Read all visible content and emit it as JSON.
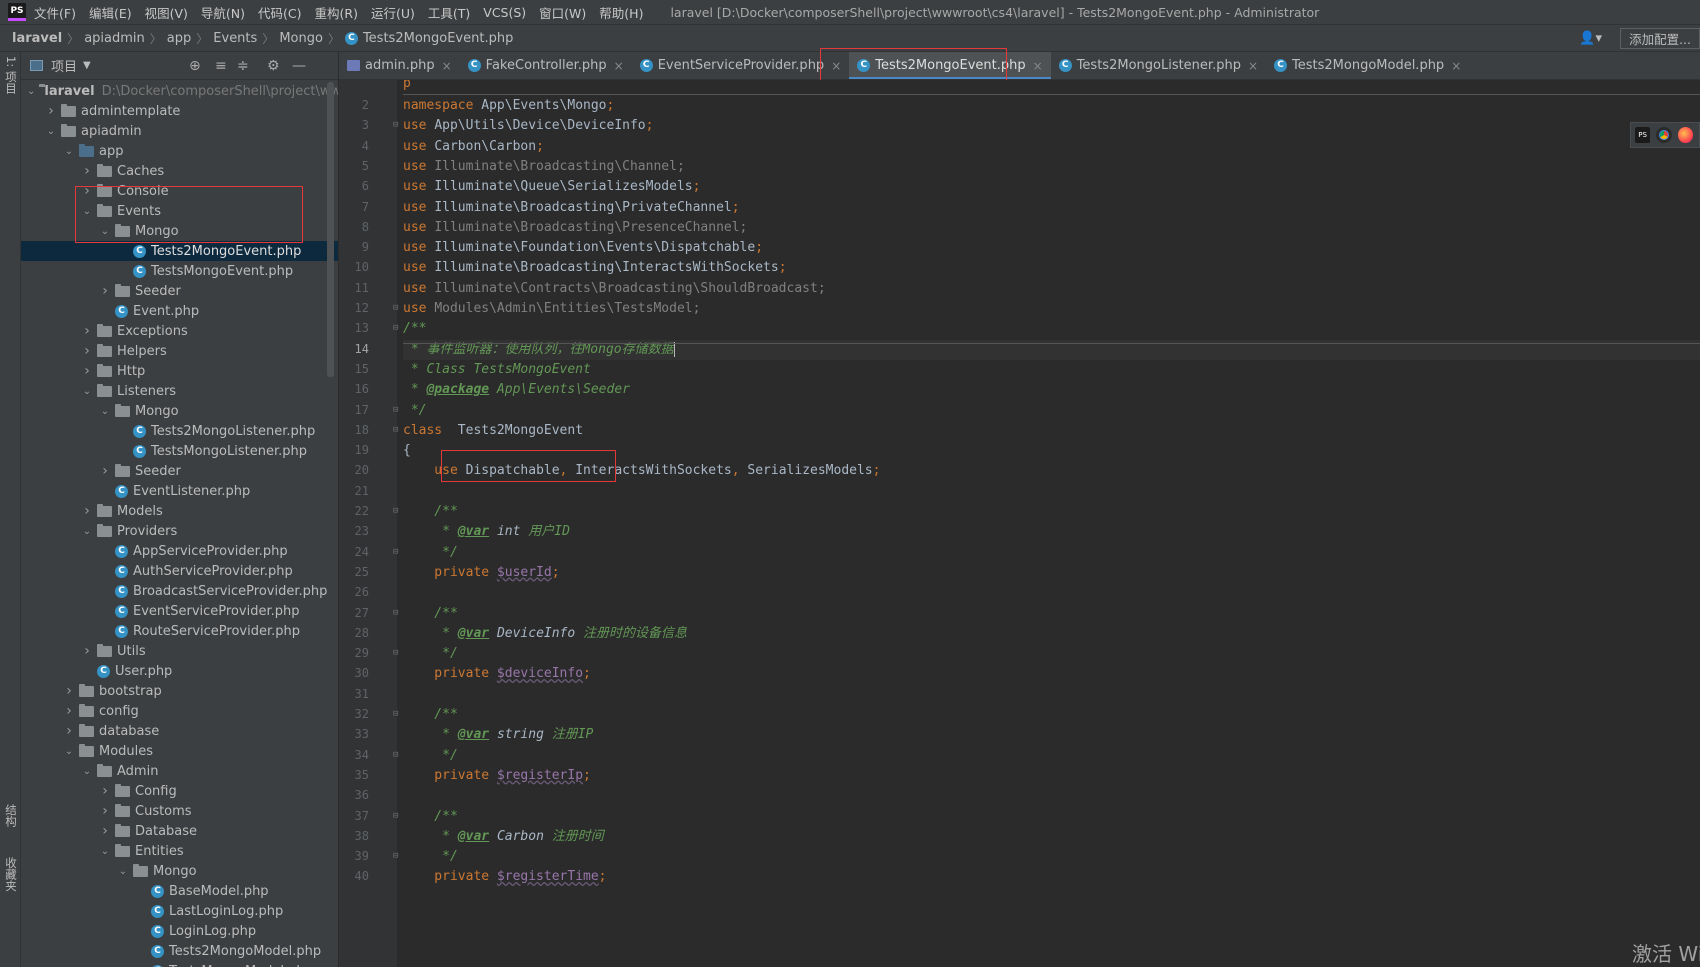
{
  "menubar": {
    "logo": "PS",
    "items": [
      "文件(F)",
      "编辑(E)",
      "视图(V)",
      "导航(N)",
      "代码(C)",
      "重构(R)",
      "运行(U)",
      "工具(T)",
      "VCS(S)",
      "窗口(W)",
      "帮助(H)"
    ],
    "window_title": "laravel [D:\\Docker\\composerShell\\project\\wwwroot\\cs4\\laravel] - Tests2MongoEvent.php - Administrator"
  },
  "breadcrumb": {
    "items": [
      "laravel",
      "apiadmin",
      "app",
      "Events",
      "Mongo",
      "Tests2MongoEvent.php"
    ],
    "add_config_label": "添加配置..."
  },
  "left_strip": {
    "top_tab": "1: 项目",
    "bottom_tab_1": "结构",
    "bottom_tab_2": "收藏夹"
  },
  "project": {
    "title": "项目",
    "root_name": "laravel",
    "root_path": "D:\\Docker\\composerShell\\project\\wwwroot\\cs4\\laravel",
    "tree": [
      {
        "label": "admintemplate",
        "depth": 1,
        "type": "folder",
        "open": false
      },
      {
        "label": "apiadmin",
        "depth": 1,
        "type": "folder",
        "open": true
      },
      {
        "label": "app",
        "depth": 2,
        "type": "folder-blue",
        "open": true
      },
      {
        "label": "Caches",
        "depth": 3,
        "type": "folder",
        "open": false
      },
      {
        "label": "Console",
        "depth": 3,
        "type": "folder",
        "open": false
      },
      {
        "label": "Events",
        "depth": 3,
        "type": "folder",
        "open": true
      },
      {
        "label": "Mongo",
        "depth": 4,
        "type": "folder",
        "open": true
      },
      {
        "label": "Tests2MongoEvent.php",
        "depth": 5,
        "type": "file",
        "selected": true
      },
      {
        "label": "TestsMongoEvent.php",
        "depth": 5,
        "type": "file"
      },
      {
        "label": "Seeder",
        "depth": 4,
        "type": "folder",
        "open": false
      },
      {
        "label": "Event.php",
        "depth": 4,
        "type": "file"
      },
      {
        "label": "Exceptions",
        "depth": 3,
        "type": "folder",
        "open": false
      },
      {
        "label": "Helpers",
        "depth": 3,
        "type": "folder",
        "open": false
      },
      {
        "label": "Http",
        "depth": 3,
        "type": "folder",
        "open": false
      },
      {
        "label": "Listeners",
        "depth": 3,
        "type": "folder",
        "open": true
      },
      {
        "label": "Mongo",
        "depth": 4,
        "type": "folder",
        "open": true
      },
      {
        "label": "Tests2MongoListener.php",
        "depth": 5,
        "type": "file"
      },
      {
        "label": "TestsMongoListener.php",
        "depth": 5,
        "type": "file"
      },
      {
        "label": "Seeder",
        "depth": 4,
        "type": "folder",
        "open": false
      },
      {
        "label": "EventListener.php",
        "depth": 4,
        "type": "file"
      },
      {
        "label": "Models",
        "depth": 3,
        "type": "folder",
        "open": false
      },
      {
        "label": "Providers",
        "depth": 3,
        "type": "folder",
        "open": true
      },
      {
        "label": "AppServiceProvider.php",
        "depth": 4,
        "type": "file"
      },
      {
        "label": "AuthServiceProvider.php",
        "depth": 4,
        "type": "file"
      },
      {
        "label": "BroadcastServiceProvider.php",
        "depth": 4,
        "type": "file"
      },
      {
        "label": "EventServiceProvider.php",
        "depth": 4,
        "type": "file"
      },
      {
        "label": "RouteServiceProvider.php",
        "depth": 4,
        "type": "file"
      },
      {
        "label": "Utils",
        "depth": 3,
        "type": "folder",
        "open": false
      },
      {
        "label": "User.php",
        "depth": 3,
        "type": "file"
      },
      {
        "label": "bootstrap",
        "depth": 2,
        "type": "folder",
        "open": false
      },
      {
        "label": "config",
        "depth": 2,
        "type": "folder",
        "open": false
      },
      {
        "label": "database",
        "depth": 2,
        "type": "folder",
        "open": false
      },
      {
        "label": "Modules",
        "depth": 2,
        "type": "folder",
        "open": true
      },
      {
        "label": "Admin",
        "depth": 3,
        "type": "folder",
        "open": true
      },
      {
        "label": "Config",
        "depth": 4,
        "type": "folder",
        "open": false
      },
      {
        "label": "Customs",
        "depth": 4,
        "type": "folder",
        "open": false
      },
      {
        "label": "Database",
        "depth": 4,
        "type": "folder",
        "open": false
      },
      {
        "label": "Entities",
        "depth": 4,
        "type": "folder",
        "open": true
      },
      {
        "label": "Mongo",
        "depth": 5,
        "type": "folder",
        "open": true
      },
      {
        "label": "BaseModel.php",
        "depth": 6,
        "type": "file"
      },
      {
        "label": "LastLoginLog.php",
        "depth": 6,
        "type": "file"
      },
      {
        "label": "LoginLog.php",
        "depth": 6,
        "type": "file"
      },
      {
        "label": "Tests2MongoModel.php",
        "depth": 6,
        "type": "file"
      },
      {
        "label": "TestsMongoModel.php",
        "depth": 6,
        "type": "file"
      }
    ]
  },
  "tabs": [
    {
      "label": "admin.php",
      "icon": "php-file-icon",
      "active": false
    },
    {
      "label": "FakeController.php",
      "icon": "class-icon",
      "active": false
    },
    {
      "label": "EventServiceProvider.php",
      "icon": "class-icon",
      "active": false
    },
    {
      "label": "Tests2MongoEvent.php",
      "icon": "class-icon",
      "active": true
    },
    {
      "label": "Tests2MongoListener.php",
      "icon": "class-icon",
      "active": false
    },
    {
      "label": "Tests2MongoModel.php",
      "icon": "class-icon",
      "active": false
    }
  ],
  "editor": {
    "current_line": 14,
    "lines": [
      {
        "n": 2,
        "segs": [
          [
            "k",
            "namespace "
          ],
          [
            "",
            "App\\Events\\Mongo"
          ],
          [
            "p",
            ";"
          ]
        ]
      },
      {
        "n": 3,
        "fold": true,
        "segs": [
          [
            "k",
            "use "
          ],
          [
            "",
            "App\\Utils\\Device\\DeviceInfo"
          ],
          [
            "p",
            ";"
          ]
        ]
      },
      {
        "n": 4,
        "segs": [
          [
            "k",
            "use "
          ],
          [
            "",
            "Carbon\\Carbon"
          ],
          [
            "p",
            ";"
          ]
        ]
      },
      {
        "n": 5,
        "segs": [
          [
            "k",
            "use "
          ],
          [
            "g",
            "Illuminate\\Broadcasting\\Channel;"
          ]
        ]
      },
      {
        "n": 6,
        "segs": [
          [
            "k",
            "use "
          ],
          [
            "",
            "Illuminate\\Queue\\SerializesModels"
          ],
          [
            "p",
            ";"
          ]
        ]
      },
      {
        "n": 7,
        "segs": [
          [
            "k",
            "use "
          ],
          [
            "",
            "Illuminate\\Broadcasting\\PrivateChannel"
          ],
          [
            "p",
            ";"
          ]
        ]
      },
      {
        "n": 8,
        "segs": [
          [
            "k",
            "use "
          ],
          [
            "g",
            "Illuminate\\Broadcasting\\PresenceChannel;"
          ]
        ]
      },
      {
        "n": 9,
        "segs": [
          [
            "k",
            "use "
          ],
          [
            "",
            "Illuminate\\Foundation\\Events\\Dispatchable"
          ],
          [
            "p",
            ";"
          ]
        ]
      },
      {
        "n": 10,
        "segs": [
          [
            "k",
            "use "
          ],
          [
            "",
            "Illuminate\\Broadcasting\\InteractsWithSockets"
          ],
          [
            "p",
            ";"
          ]
        ]
      },
      {
        "n": 11,
        "segs": [
          [
            "k",
            "use "
          ],
          [
            "g",
            "Illuminate\\Contracts\\Broadcasting\\ShouldBroadcast;"
          ]
        ]
      },
      {
        "n": 12,
        "fold": true,
        "segs": [
          [
            "k",
            "use "
          ],
          [
            "g",
            "Modules\\Admin\\Entities\\TestsModel;"
          ]
        ]
      },
      {
        "n": 13,
        "fold": true,
        "segs": [
          [
            "d",
            "/**"
          ]
        ]
      },
      {
        "n": 14,
        "segs": [
          [
            "d",
            " * 事件监听器：使用队列，往Mongo存储数据"
          ]
        ]
      },
      {
        "n": 15,
        "segs": [
          [
            "d",
            " * Class TestsMongoEvent"
          ]
        ]
      },
      {
        "n": 16,
        "segs": [
          [
            "d",
            " * "
          ],
          [
            "dt",
            "@package"
          ],
          [
            "d",
            " App\\Events\\Seeder"
          ]
        ]
      },
      {
        "n": 17,
        "fold": true,
        "segs": [
          [
            "d",
            " */"
          ]
        ]
      },
      {
        "n": 18,
        "fold": true,
        "segs": [
          [
            "k",
            "class "
          ],
          [
            "",
            " Tests2MongoEvent"
          ]
        ]
      },
      {
        "n": 19,
        "segs": [
          [
            "",
            "{"
          ]
        ]
      },
      {
        "n": 20,
        "segs": [
          [
            "k",
            "    use "
          ],
          [
            "",
            "Dispatchable"
          ],
          [
            "p",
            ", "
          ],
          [
            "",
            "InteractsWithSockets"
          ],
          [
            "p",
            ", "
          ],
          [
            "",
            "SerializesModels"
          ],
          [
            "p",
            ";"
          ]
        ]
      },
      {
        "n": 21,
        "segs": [
          [
            "",
            ""
          ]
        ]
      },
      {
        "n": 22,
        "fold": true,
        "segs": [
          [
            "d",
            "    /**"
          ]
        ]
      },
      {
        "n": 23,
        "segs": [
          [
            "d",
            "     * "
          ],
          [
            "dt",
            "@var"
          ],
          [
            "d",
            " "
          ],
          [
            "ty",
            "int"
          ],
          [
            "c",
            " 用户ID"
          ]
        ]
      },
      {
        "n": 24,
        "fold": true,
        "segs": [
          [
            "d",
            "     */"
          ]
        ]
      },
      {
        "n": 25,
        "segs": [
          [
            "k",
            "    private "
          ],
          [
            "v",
            "$userId"
          ],
          [
            "p",
            ";"
          ]
        ]
      },
      {
        "n": 26,
        "segs": [
          [
            "",
            ""
          ]
        ]
      },
      {
        "n": 27,
        "fold": true,
        "segs": [
          [
            "d",
            "    /**"
          ]
        ]
      },
      {
        "n": 28,
        "segs": [
          [
            "d",
            "     * "
          ],
          [
            "dt",
            "@var"
          ],
          [
            "d",
            " "
          ],
          [
            "ty",
            "DeviceInfo"
          ],
          [
            "c",
            " 注册时的设备信息"
          ]
        ]
      },
      {
        "n": 29,
        "fold": true,
        "segs": [
          [
            "d",
            "     */"
          ]
        ]
      },
      {
        "n": 30,
        "segs": [
          [
            "k",
            "    private "
          ],
          [
            "v",
            "$deviceInfo"
          ],
          [
            "p",
            ";"
          ]
        ]
      },
      {
        "n": 31,
        "segs": [
          [
            "",
            ""
          ]
        ]
      },
      {
        "n": 32,
        "fold": true,
        "segs": [
          [
            "d",
            "    /**"
          ]
        ]
      },
      {
        "n": 33,
        "segs": [
          [
            "d",
            "     * "
          ],
          [
            "dt",
            "@var"
          ],
          [
            "d",
            " "
          ],
          [
            "ty",
            "string"
          ],
          [
            "c",
            " 注册IP"
          ]
        ]
      },
      {
        "n": 34,
        "fold": true,
        "segs": [
          [
            "d",
            "     */"
          ]
        ]
      },
      {
        "n": 35,
        "segs": [
          [
            "k",
            "    private "
          ],
          [
            "v",
            "$registerIp"
          ],
          [
            "p",
            ";"
          ]
        ]
      },
      {
        "n": 36,
        "segs": [
          [
            "",
            ""
          ]
        ]
      },
      {
        "n": 37,
        "fold": true,
        "segs": [
          [
            "d",
            "    /**"
          ]
        ]
      },
      {
        "n": 38,
        "segs": [
          [
            "d",
            "     * "
          ],
          [
            "dt",
            "@var"
          ],
          [
            "d",
            " "
          ],
          [
            "ty",
            "Carbon"
          ],
          [
            "c",
            " 注册时间"
          ]
        ]
      },
      {
        "n": 39,
        "fold": true,
        "segs": [
          [
            "d",
            "     */"
          ]
        ]
      },
      {
        "n": 40,
        "segs": [
          [
            "k",
            "    private "
          ],
          [
            "v",
            "$registerTime"
          ],
          [
            "p",
            ";"
          ]
        ]
      }
    ],
    "first_line_partial": "p"
  },
  "browser_icons": [
    "phpstorm-icon",
    "chrome-icon",
    "firefox-icon"
  ],
  "watermark": "激活 Wi"
}
